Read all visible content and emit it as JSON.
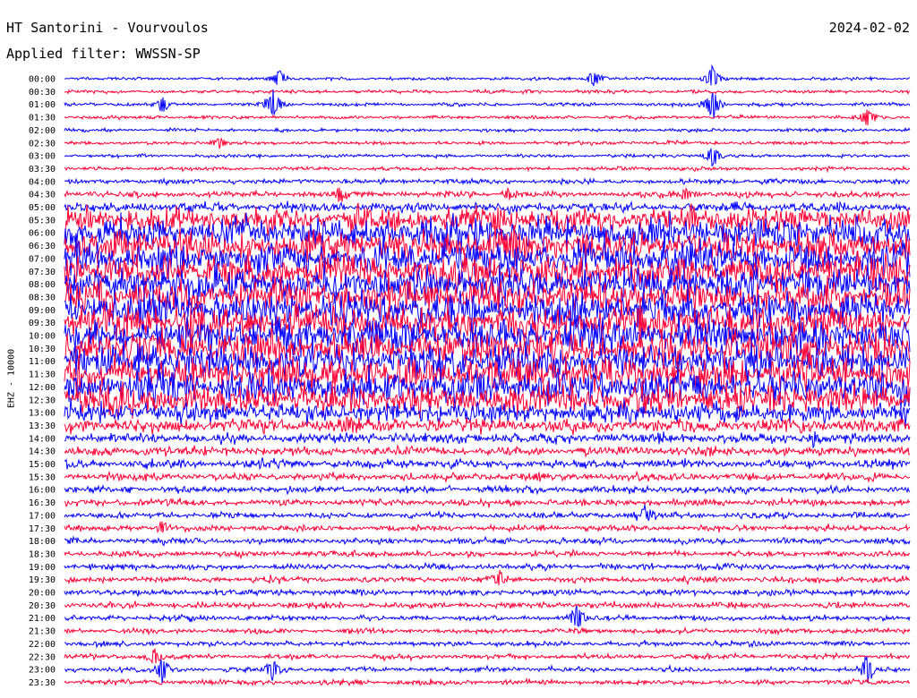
{
  "header": {
    "title": "HT Santorini - Vourvoulos",
    "date": "2024-02-02",
    "filter": "Applied filter: WWSSN-SP"
  },
  "chart_data": {
    "type": "helicorder",
    "channel_label": "EHZ - 10000",
    "colors": {
      "trace_a": "#0000ff",
      "trace_b": "#ff0033"
    },
    "row_interval_minutes": 30,
    "rows": [
      {
        "label": "00:00",
        "amp": 0.18
      },
      {
        "label": "00:30",
        "amp": 0.2
      },
      {
        "label": "01:00",
        "amp": 0.2
      },
      {
        "label": "01:30",
        "amp": 0.2
      },
      {
        "label": "02:00",
        "amp": 0.2
      },
      {
        "label": "02:30",
        "amp": 0.2
      },
      {
        "label": "03:00",
        "amp": 0.2
      },
      {
        "label": "03:30",
        "amp": 0.22
      },
      {
        "label": "04:00",
        "amp": 0.3
      },
      {
        "label": "04:30",
        "amp": 0.35
      },
      {
        "label": "05:00",
        "amp": 0.55
      },
      {
        "label": "05:30",
        "amp": 1.5
      },
      {
        "label": "06:00",
        "amp": 1.8
      },
      {
        "label": "06:30",
        "amp": 1.9
      },
      {
        "label": "07:00",
        "amp": 2.0
      },
      {
        "label": "07:30",
        "amp": 2.0
      },
      {
        "label": "08:00",
        "amp": 2.0
      },
      {
        "label": "08:30",
        "amp": 2.0
      },
      {
        "label": "09:00",
        "amp": 2.0
      },
      {
        "label": "09:30",
        "amp": 2.0
      },
      {
        "label": "10:00",
        "amp": 2.0
      },
      {
        "label": "10:30",
        "amp": 2.0
      },
      {
        "label": "11:00",
        "amp": 2.0
      },
      {
        "label": "11:30",
        "amp": 2.0
      },
      {
        "label": "12:00",
        "amp": 2.0
      },
      {
        "label": "12:30",
        "amp": 1.8
      },
      {
        "label": "13:00",
        "amp": 1.2
      },
      {
        "label": "13:30",
        "amp": 0.8
      },
      {
        "label": "14:00",
        "amp": 0.6
      },
      {
        "label": "14:30",
        "amp": 0.55
      },
      {
        "label": "15:00",
        "amp": 0.5
      },
      {
        "label": "15:30",
        "amp": 0.45
      },
      {
        "label": "16:00",
        "amp": 0.4
      },
      {
        "label": "16:30",
        "amp": 0.4
      },
      {
        "label": "17:00",
        "amp": 0.35
      },
      {
        "label": "17:30",
        "amp": 0.35
      },
      {
        "label": "18:00",
        "amp": 0.35
      },
      {
        "label": "18:30",
        "amp": 0.35
      },
      {
        "label": "19:00",
        "amp": 0.35
      },
      {
        "label": "19:30",
        "amp": 0.35
      },
      {
        "label": "20:00",
        "amp": 0.35
      },
      {
        "label": "20:30",
        "amp": 0.35
      },
      {
        "label": "21:00",
        "amp": 0.3
      },
      {
        "label": "21:30",
        "amp": 0.3
      },
      {
        "label": "22:00",
        "amp": 0.3
      },
      {
        "label": "22:30",
        "amp": 0.3
      },
      {
        "label": "23:00",
        "amp": 0.3
      },
      {
        "label": "23:30",
        "amp": 0.3
      }
    ],
    "events": [
      {
        "row": 0,
        "minute": 7.6,
        "amp": 1.6
      },
      {
        "row": 0,
        "minute": 18.8,
        "amp": 1.4
      },
      {
        "row": 0,
        "minute": 23.0,
        "amp": 1.8
      },
      {
        "row": 2,
        "minute": 3.5,
        "amp": 1.2
      },
      {
        "row": 2,
        "minute": 7.4,
        "amp": 2.2
      },
      {
        "row": 2,
        "minute": 23.0,
        "amp": 2.5
      },
      {
        "row": 3,
        "minute": 28.5,
        "amp": 1.5
      },
      {
        "row": 5,
        "minute": 5.5,
        "amp": 1.0
      },
      {
        "row": 6,
        "minute": 23.0,
        "amp": 1.6
      },
      {
        "row": 9,
        "minute": 9.8,
        "amp": 1.2
      },
      {
        "row": 9,
        "minute": 15.8,
        "amp": 1.0
      },
      {
        "row": 9,
        "minute": 22.1,
        "amp": 1.0
      },
      {
        "row": 27,
        "minute": 10.1,
        "amp": 1.8
      },
      {
        "row": 28,
        "minute": 26.6,
        "amp": 1.2
      },
      {
        "row": 34,
        "minute": 20.6,
        "amp": 1.2
      },
      {
        "row": 35,
        "minute": 3.5,
        "amp": 1.2
      },
      {
        "row": 39,
        "minute": 15.4,
        "amp": 1.2
      },
      {
        "row": 42,
        "minute": 18.2,
        "amp": 2.0
      },
      {
        "row": 45,
        "minute": 3.2,
        "amp": 1.4
      },
      {
        "row": 46,
        "minute": 3.5,
        "amp": 2.0
      },
      {
        "row": 46,
        "minute": 7.4,
        "amp": 1.6
      },
      {
        "row": 46,
        "minute": 28.5,
        "amp": 2.0
      }
    ]
  }
}
